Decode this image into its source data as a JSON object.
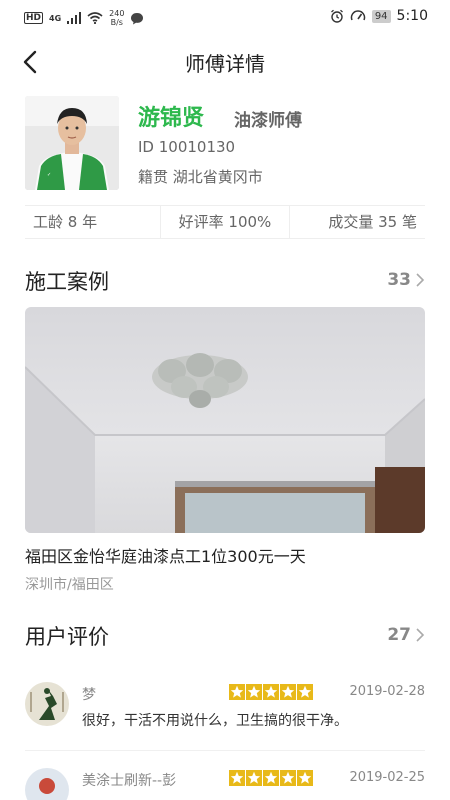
{
  "status_bar": {
    "hd": "HD",
    "network": "4G",
    "speed_value": "240",
    "speed_unit": "B/s",
    "battery": "94",
    "time": "5:10"
  },
  "nav": {
    "title": "师傅详情",
    "back_icon": "chevron-left-icon"
  },
  "profile": {
    "name": "游锦贤",
    "title": "油漆师傅",
    "id_text": "ID 10010130",
    "origin": "籍贯 湖北省黄冈市",
    "name_color": "#2db84d"
  },
  "stats": {
    "experience": "工龄 8 年",
    "rating": "好评率 100%",
    "deals": "成交量 35 笔"
  },
  "cases": {
    "title": "施工案例",
    "count": "33",
    "items": [
      {
        "title": "福田区金怡华庭油漆点工1位300元一天",
        "location": "深圳市/福田区"
      }
    ]
  },
  "reviews": {
    "title": "用户评价",
    "count": "27",
    "star_color": "#e8b919",
    "items": [
      {
        "user": "梦",
        "stars": 5,
        "date": "2019-02-28",
        "text": "很好，干活不用说什么，卫生搞的很干净。"
      },
      {
        "user": "美涂士刷新--彭",
        "stars": 5,
        "date": "2019-02-25",
        "text": ""
      }
    ]
  }
}
